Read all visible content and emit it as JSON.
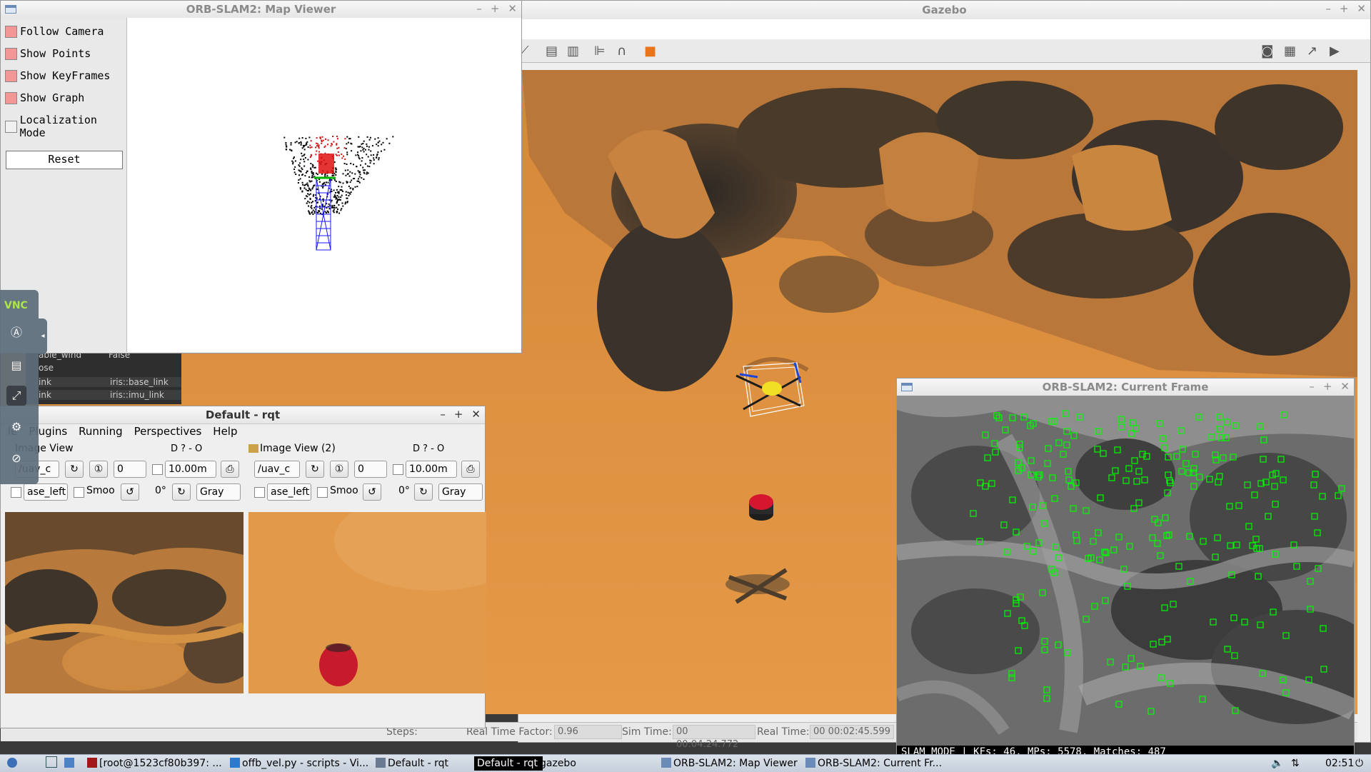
{
  "gazebo": {
    "title": "Gazebo",
    "status": {
      "steps_label": "Steps:",
      "rtf_label": "Real Time Factor:",
      "rtf_value": "0.96",
      "sim_label": "Sim Time:",
      "sim_value": "00 00:04:24.772",
      "real_label": "Real Time:",
      "real_value": "00 00:02:45.599"
    }
  },
  "map_viewer": {
    "title": "ORB-SLAM2: Map Viewer",
    "options": [
      {
        "label": "Follow Camera",
        "checked": true
      },
      {
        "label": "Show Points",
        "checked": true
      },
      {
        "label": "Show KeyFrames",
        "checked": true
      },
      {
        "label": "Show Graph",
        "checked": true
      },
      {
        "label": "Localization Mode",
        "checked": false
      }
    ],
    "reset_label": "Reset"
  },
  "current_frame": {
    "title": "ORB-SLAM2: Current Frame",
    "status_text": "SLAM MODE |  KFs: 46, MPs: 5578, Matches: 487"
  },
  "rqt": {
    "title": "Default - rqt",
    "menu": [
      "le",
      "Plugins",
      "Running",
      "Perspectives",
      "Help"
    ],
    "panels": [
      {
        "title": "Image View",
        "topic": "/uav_c",
        "num": "0",
        "max": "10.00m",
        "topic2": "ase_left",
        "smooth": "Smoo",
        "rotation": "0°",
        "color": "Gray",
        "controls": "D ? - O"
      },
      {
        "title": "Image View (2)",
        "topic": "/uav_c",
        "num": "0",
        "max": "10.00m",
        "topic2": "ase_left",
        "smooth": "Smoo",
        "rotation": "0°",
        "color": "Gray",
        "controls": "D ? - O"
      }
    ]
  },
  "bg_tree": {
    "rows": [
      {
        "name": "able_wind",
        "value": "False"
      },
      {
        "name": "ose",
        "value": ""
      },
      {
        "name": "ink",
        "value": "iris::base_link"
      },
      {
        "name": "ink",
        "value": "iris::imu_link"
      }
    ]
  },
  "vnc": {
    "logo": "VNC"
  },
  "taskbar": {
    "items": [
      "[root@1523cf80b397: ...",
      "offb_vel.py - scripts - Vi...",
      "Default - rqt",
      "Default - rqt",
      "gazebo",
      "ORB-SLAM2: Map Viewer",
      "ORB-SLAM2: Current Fr..."
    ],
    "clock": "02:51"
  },
  "colors": {
    "terrain": "#e0923e",
    "shadow": "#3c352d",
    "feature": "#00ff00",
    "checked": "#f29696",
    "ball": "#c8192c"
  }
}
